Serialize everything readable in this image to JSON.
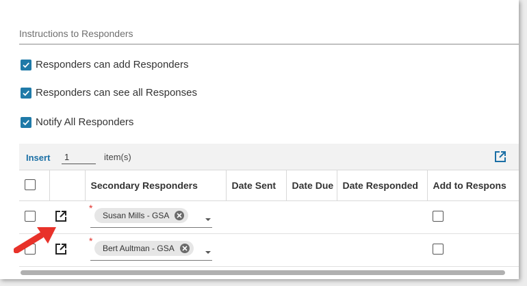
{
  "instructions": {
    "placeholder": "Instructions to Responders",
    "value": ""
  },
  "options": [
    {
      "label": "Responders can add Responders",
      "checked": true
    },
    {
      "label": "Responders can see all Responses",
      "checked": true
    },
    {
      "label": "Notify All Responders",
      "checked": true
    }
  ],
  "toolbar": {
    "insert_label": "Insert",
    "quantity": "1",
    "items_label": "item(s)",
    "external_icon": "open-external-icon"
  },
  "table": {
    "headers": [
      "Secondary Responders",
      "Date Sent",
      "Date Due",
      "Date Responded",
      "Add to Respons"
    ],
    "rows": [
      {
        "responder": "Susan Mills - GSA",
        "date_sent": "",
        "date_due": "",
        "date_responded": "",
        "add_to_response": false
      },
      {
        "responder": "Bert Aultman - GSA",
        "date_sent": "",
        "date_due": "",
        "date_responded": "",
        "add_to_response": false
      }
    ]
  },
  "colors": {
    "accent": "#1f7aa8",
    "link": "#1a6fa5",
    "required": "#e0312b",
    "annotation_arrow": "#e8322a"
  }
}
